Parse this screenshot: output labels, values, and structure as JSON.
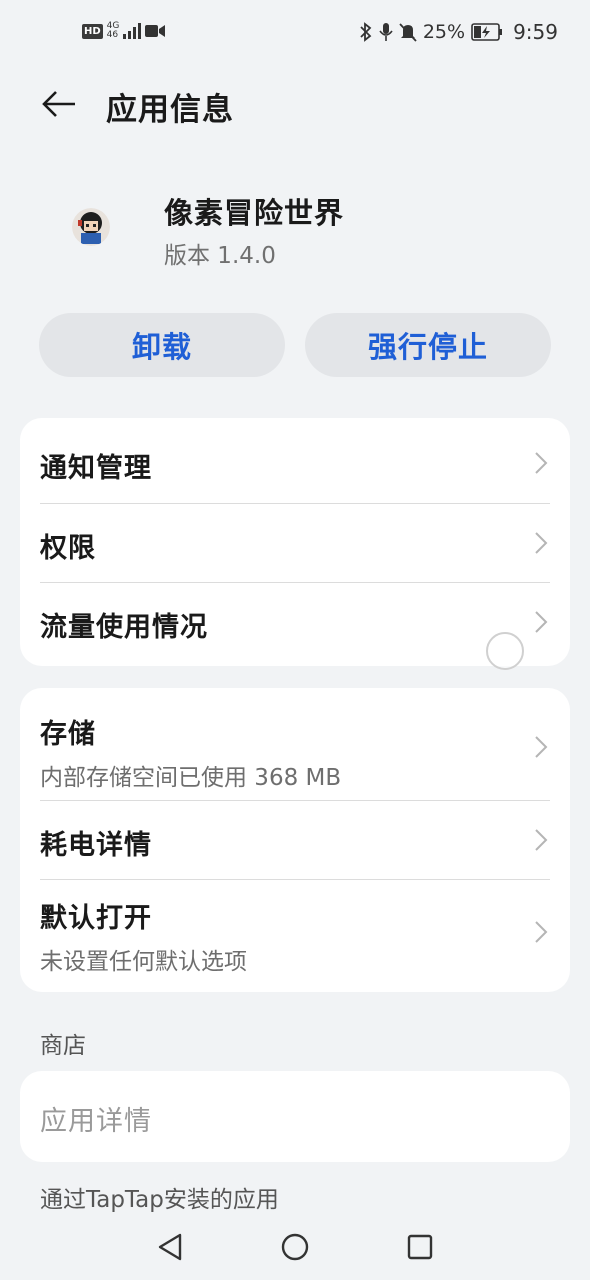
{
  "status_bar": {
    "hd": "HD",
    "network_top": "4G",
    "network_bottom": "46",
    "battery_percent": "25%",
    "time": "9:59",
    "icons": [
      "signal-icon",
      "video-icon",
      "bluetooth-icon",
      "microphone-icon",
      "mute-icon",
      "battery-charging-icon"
    ]
  },
  "header": {
    "title": "应用信息",
    "back_icon": "arrow-left-icon"
  },
  "app": {
    "name": "像素冒险世界",
    "version": "版本 1.4.0"
  },
  "actions": {
    "uninstall": "卸载",
    "force_stop": "强行停止"
  },
  "group1": {
    "items": [
      {
        "label": "通知管理"
      },
      {
        "label": "权限"
      },
      {
        "label": "流量使用情况"
      }
    ]
  },
  "group2": {
    "items": [
      {
        "label": "存储",
        "sub": "内部存储空间已使用 368 MB"
      },
      {
        "label": "耗电详情"
      },
      {
        "label": "默认打开",
        "sub": "未设置任何默认选项"
      }
    ]
  },
  "store": {
    "title": "商店",
    "item": "应用详情",
    "note": "通过TapTap安装的应用"
  },
  "colors": {
    "accent": "#1f5fd6",
    "background": "#f1f3f5",
    "card": "#ffffff"
  }
}
